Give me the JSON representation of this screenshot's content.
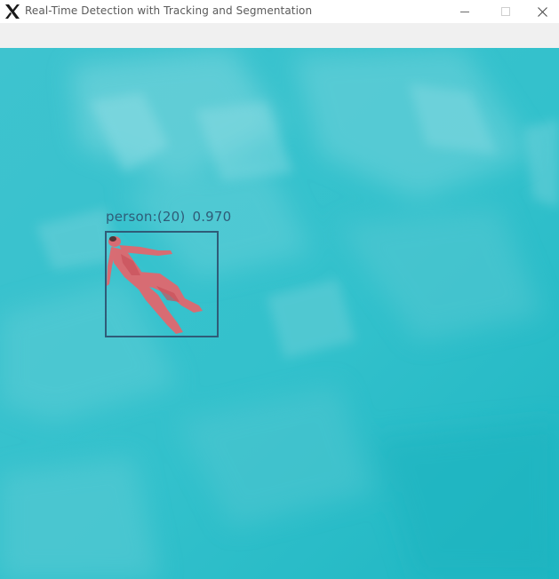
{
  "window": {
    "title": "Real-Time Detection with Tracking and Segmentation",
    "icon": "x11-x-logo-icon",
    "controls": [
      "minimize-icon",
      "maximize-icon",
      "close-icon"
    ]
  },
  "video": {
    "background_color": "#2cc3cd",
    "detection": {
      "class_label": "person:(20)",
      "confidence": "0.970",
      "box_color": "#2f5c78",
      "mask_color": "#e0686f"
    }
  }
}
